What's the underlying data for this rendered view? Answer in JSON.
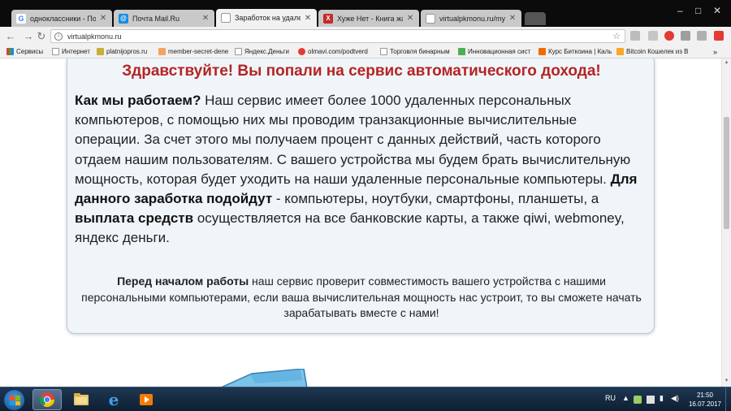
{
  "browser": {
    "tabs": [
      {
        "title": "одноклассники - Поиск",
        "icon": "google-icon",
        "active": false
      },
      {
        "title": "Почта Mail.Ru",
        "icon": "mailru-icon",
        "active": false
      },
      {
        "title": "Заработок на удаленном",
        "icon": "page-icon",
        "active": true
      },
      {
        "title": "Хуже Нет - Книга жалоб",
        "icon": "x-icon",
        "active": false
      },
      {
        "title": "virtualpkmonu.ru/mypro",
        "icon": "page-icon",
        "active": false
      }
    ],
    "address": "virtualpkmonu.ru",
    "bookmarks": [
      "Сервисы",
      "Интернет",
      "platnijopros.ru",
      "member-secret-dene",
      "Яндекс.Деньги",
      "olmavi.com/podtverd",
      "Торговля бинарным",
      "Инновационная сист",
      "Курс Биткоина | Каль",
      "Bitcoin Кошелек из В"
    ]
  },
  "page": {
    "headline": "Здравствуйте! Вы попали на сервис автоматического дохода!",
    "how_title": "Как мы работаем?",
    "how_text": " Наш сервис имеет более 1000 удаленных персональных компьютеров, с помощью них мы проводим транзакционные вычислительные операции. За счет этого мы получаем процент с данных действий, часть которого отдаем нашим пользователям. С вашего устройства мы будем брать вычислительную мощность, которая будет уходить на наши удаленные персональные компьютеры. ",
    "suitable_title": "Для данного заработка подойдут",
    "suitable_text": " - компьютеры, ноутбуки, смартфоны, планшеты, а ",
    "payout_title": "выплата средств",
    "payout_text": " осуществляется на все банковские карты, а также qiwi, webmoney, яндекс деньги.",
    "note_title": "Перед началом работы",
    "note_text": " наш сервис проверит совместимость вашего устройства с нашими персональными компьютерами, если ваша вычислительная мощность нас устроит, то вы сможете начать зарабатывать вместе с нами!"
  },
  "taskbar": {
    "lang": "RU",
    "time": "21:50",
    "date": "16.07.2017"
  },
  "colors": {
    "headline": "#b52424",
    "card_bg": "#f0f5f9"
  }
}
